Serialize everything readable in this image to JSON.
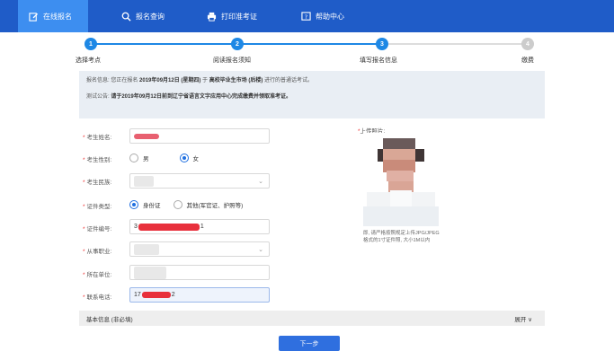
{
  "nav": {
    "tabs": [
      {
        "label": "在线报名",
        "icon": "edit-icon"
      },
      {
        "label": "报名查询",
        "icon": "search-icon"
      },
      {
        "label": "打印准考证",
        "icon": "printer-icon"
      },
      {
        "label": "帮助中心",
        "icon": "help-icon"
      }
    ]
  },
  "steps": [
    {
      "num": "1",
      "label": "选择考点",
      "state": "done"
    },
    {
      "num": "2",
      "label": "阅读报名须知",
      "state": "done"
    },
    {
      "num": "3",
      "label": "填写报名信息",
      "state": "current"
    },
    {
      "num": "4",
      "label": "缴费",
      "state": "todo"
    }
  ],
  "notice": {
    "line1_prefix": "报名信息: 您正在报名 ",
    "line1_date": "2019年09月12日 (星期四)",
    "line1_mid": " 于 ",
    "line1_place": "高校毕业生市场 (后楼)",
    "line1_suffix": " 进行的普通话考试。",
    "line2_prefix": "测试公告: ",
    "line2_text": "请于2019年09月12日前到辽宁省语言文字应用中心完成缴费并领取准考证。"
  },
  "form": {
    "name_label": "考生姓名:",
    "gender_label": "考生性别:",
    "gender_male": "男",
    "gender_female": "女",
    "gender_selected": "女",
    "ethnicity_label": "考生民族:",
    "idtype_label": "证件类型:",
    "idtype_id": "身份证",
    "idtype_other": "其他(军官证、护照等)",
    "idtype_selected": "身份证",
    "idnum_label": "证件编号:",
    "idnum_prefix": "3",
    "idnum_suffix": "1",
    "occupation_label": "从事职业:",
    "employer_label": "所在单位:",
    "phone_label": "联系电话:",
    "phone_prefix": "17",
    "phone_suffix": "2"
  },
  "photo": {
    "label": "上传照片:",
    "hint": "即, 请严格按照规定上传JPG/JPEG格式的1寸证件照, 大小1M以内"
  },
  "extra": {
    "title": "基本信息 (非必填)",
    "toggle": "展开 ∨"
  },
  "next_button": "下一步",
  "colors": {
    "nav_bg": "#1f5cc8",
    "nav_active": "#3d8ef0",
    "step_active": "#1e88e5",
    "step_todo": "#cccccc",
    "required": "#e33333",
    "redaction": "#e8303c"
  }
}
